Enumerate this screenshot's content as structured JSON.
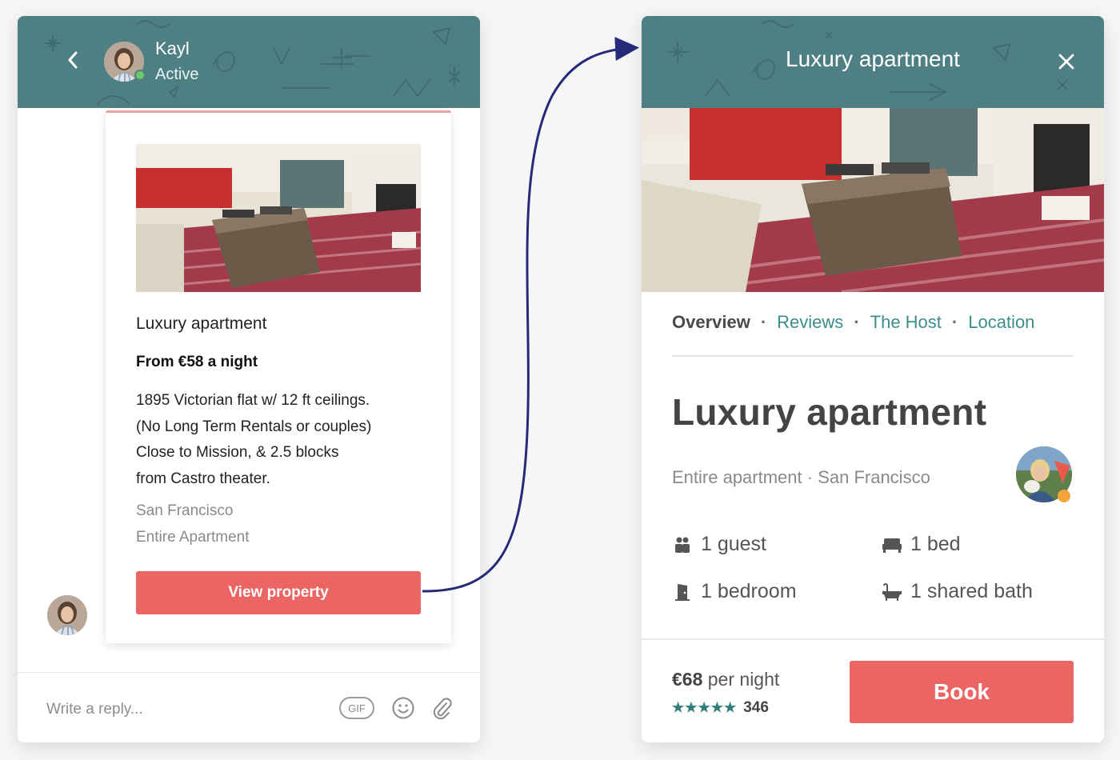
{
  "colors": {
    "header_teal": "#4d7f83",
    "accent_coral": "#ec6565",
    "link_teal": "#3b8e8c",
    "online_green": "#6dc86a",
    "arrow_navy": "#262a78"
  },
  "chat": {
    "header": {
      "back_icon": "chevron-left-icon",
      "contact_name": "Kayl",
      "contact_status": "Active"
    },
    "card": {
      "title": "Luxury apartment",
      "price": "From €58 a night",
      "description_lines": [
        "1895 Victorian flat w/ 12 ft ceilings.",
        "(No Long Term Rentals or couples)",
        "Close to Mission, & 2.5 blocks",
        "from Castro theater."
      ],
      "location": "San Francisco",
      "type": "Entire Apartment",
      "button_label": "View property"
    },
    "composer": {
      "placeholder": "Write a reply...",
      "gif_label": "GIF",
      "emoji_icon": "smiley-icon",
      "attach_icon": "paperclip-icon"
    }
  },
  "detail": {
    "header": {
      "title": "Luxury apartment",
      "close_icon": "close-icon"
    },
    "tabs": [
      {
        "label": "Overview"
      },
      {
        "label": "Reviews"
      },
      {
        "label": "The Host"
      },
      {
        "label": "Location"
      }
    ],
    "tab_separator": "·",
    "heading": "Luxury apartment",
    "subtitle": "Entire apartment · San Francisco",
    "amenities": [
      {
        "icon": "guests-icon",
        "label": "1 guest"
      },
      {
        "icon": "bed-icon",
        "label": "1 bed"
      },
      {
        "icon": "door-icon",
        "label": "1 bedroom"
      },
      {
        "icon": "bathtub-icon",
        "label": "1 shared bath"
      }
    ],
    "footer": {
      "price_amount": "€68",
      "price_unit": "per night",
      "stars": "★★★★★",
      "rating_count": "346",
      "book_label": "Book"
    }
  }
}
